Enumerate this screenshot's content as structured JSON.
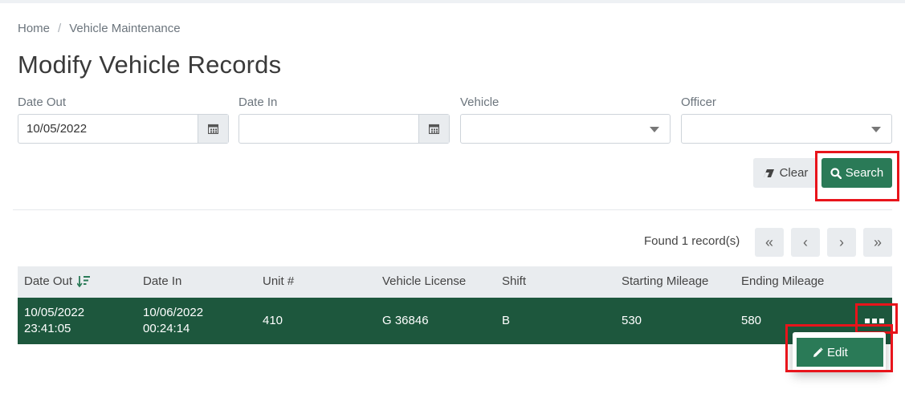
{
  "breadcrumb": {
    "home": "Home",
    "separator": "/",
    "current": "Vehicle Maintenance"
  },
  "page": {
    "title": "Modify Vehicle Records"
  },
  "filters": {
    "date_out": {
      "label": "Date Out",
      "value": "10/05/2022",
      "icon": "calendar-icon"
    },
    "date_in": {
      "label": "Date In",
      "value": "",
      "icon": "calendar-icon"
    },
    "vehicle": {
      "label": "Vehicle",
      "value": ""
    },
    "officer": {
      "label": "Officer",
      "value": ""
    }
  },
  "actions": {
    "clear_label": "Clear",
    "search_label": "Search"
  },
  "results": {
    "found_text": "Found 1 record(s)"
  },
  "pagination": {
    "first": "«",
    "prev": "‹",
    "next": "›",
    "last": "»"
  },
  "table": {
    "headers": [
      "Date Out",
      "Date In",
      "Unit #",
      "Vehicle License",
      "Shift",
      "Starting Mileage",
      "Ending Mileage"
    ],
    "rows": [
      {
        "date_out_date": "10/05/2022",
        "date_out_time": "23:41:05",
        "date_in_date": "10/06/2022",
        "date_in_time": "00:24:14",
        "unit": "410",
        "license": "G 36846",
        "shift": "B",
        "start_mileage": "530",
        "end_mileage": "580"
      }
    ]
  },
  "row_menu": {
    "edit_label": "Edit"
  },
  "colors": {
    "primary": "#2a7a57",
    "row_selected": "#1d573d",
    "highlight": "#e8141b"
  }
}
